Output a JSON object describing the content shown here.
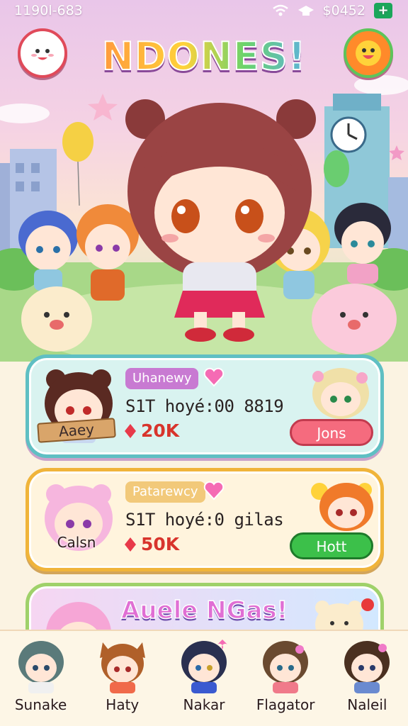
{
  "status_bar": {
    "time": "1190l-683",
    "balance": "$0452",
    "plus_label": "+"
  },
  "header": {
    "title": "NDONES!"
  },
  "cards": [
    {
      "character_name": "Aaey",
      "tag": "Uhanewy",
      "stat": "S1T hoyé:00 8819",
      "reward": "20K",
      "button": "Jons",
      "accent": "#5fbfc3"
    },
    {
      "character_name": "Calsn",
      "tag": "Patarewcy",
      "stat": "S1T hoyé:0 gilas",
      "reward": "50K",
      "button": "Hott",
      "accent": "#f0b43a"
    },
    {
      "banner": "Auele NGas!"
    }
  ],
  "bottom_nav": [
    {
      "label": "Sunake",
      "hair": "#5a7a7a"
    },
    {
      "label": "Haty",
      "hair": "#b0602a"
    },
    {
      "label": "Nakar",
      "hair": "#2a3050"
    },
    {
      "label": "Flagator",
      "hair": "#6a4a30"
    },
    {
      "label": "Naleil",
      "hair": "#4a3020"
    }
  ],
  "colors": {
    "pink": "#f56b7e",
    "green": "#3cc04a",
    "teal": "#5fbfc3",
    "gold": "#f0b43a"
  }
}
